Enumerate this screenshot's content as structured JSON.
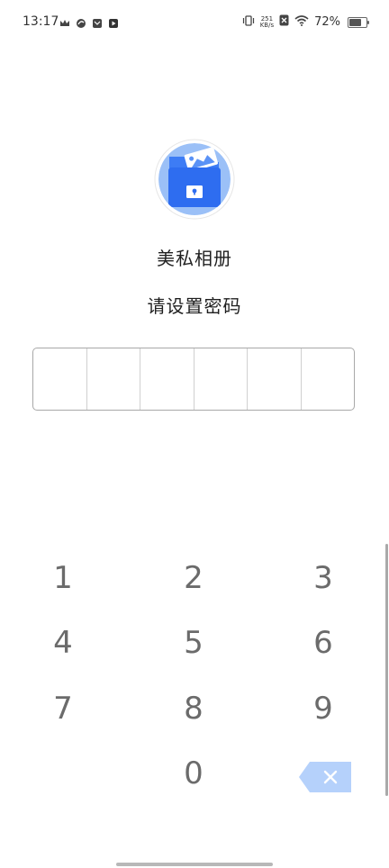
{
  "status_bar": {
    "time": "13:17",
    "net_speed_value": "251",
    "net_speed_unit": "KB/s",
    "battery_text": "72%",
    "battery_level": 0.72,
    "left_icons": [
      "crown-icon",
      "swirl-icon",
      "mail-icon",
      "play-icon"
    ],
    "right_icons": [
      "vibrate-icon",
      "net-speed",
      "no-sim-icon",
      "wifi-icon",
      "battery-icon"
    ]
  },
  "app": {
    "logo_icon": "private-album-folder-lock-icon",
    "name": "美私相册",
    "prompt": "请设置密码"
  },
  "pin": {
    "length": 6,
    "entered": ""
  },
  "keypad": {
    "keys": [
      "1",
      "2",
      "3",
      "4",
      "5",
      "6",
      "7",
      "8",
      "9",
      "0"
    ],
    "delete_icon": "backspace-icon"
  },
  "colors": {
    "logo_blue": "#3d7cf5",
    "logo_bg": "#9bc0f7",
    "delete_blue": "#b5d1fb",
    "key_text": "#6b6b6b"
  }
}
